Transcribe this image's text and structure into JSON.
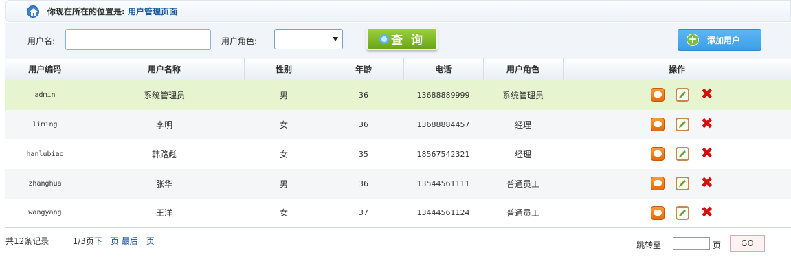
{
  "breadcrumb": {
    "prefix": "你现在所在的位置是:",
    "current": "用户管理页面"
  },
  "search": {
    "username_label": "用户名:",
    "username_value": "",
    "role_label": "用户角色:",
    "role_value": "",
    "query_label": "查 询",
    "add_label": "添加用户"
  },
  "table": {
    "headers": [
      "用户编码",
      "用户名称",
      "性别",
      "年龄",
      "电话",
      "用户角色",
      "操作"
    ],
    "rows": [
      {
        "code": "admin",
        "name": "系统管理员",
        "gender": "男",
        "age": "36",
        "phone": "13688889999",
        "role": "系统管理员"
      },
      {
        "code": "liming",
        "name": "李明",
        "gender": "女",
        "age": "36",
        "phone": "13688884457",
        "role": "经理"
      },
      {
        "code": "hanlubiao",
        "name": "韩路彪",
        "gender": "女",
        "age": "35",
        "phone": "18567542321",
        "role": "经理"
      },
      {
        "code": "zhanghua",
        "name": "张华",
        "gender": "男",
        "age": "36",
        "phone": "13544561111",
        "role": "普通员工"
      },
      {
        "code": "wangyang",
        "name": "王洋",
        "gender": "女",
        "age": "37",
        "phone": "13444561124",
        "role": "普通员工"
      }
    ]
  },
  "pager": {
    "total": "共12条记录",
    "page": "1/3页",
    "next": "下一页",
    "last": "最后一页",
    "goto_label": "跳转至",
    "goto_value": "",
    "page_unit": "页",
    "go_label": "GO"
  },
  "icons": {
    "home": "home-icon",
    "search": "search-icon",
    "add": "plus-icon",
    "view": "view-icon",
    "edit": "edit-icon",
    "delete": "delete-icon"
  },
  "colors": {
    "header_blue": "#1a5b9c",
    "query_green": "#7dbb28",
    "add_blue": "#43a6ee",
    "highlight_row": "#e6f4d0",
    "delete_red": "#d31010"
  }
}
